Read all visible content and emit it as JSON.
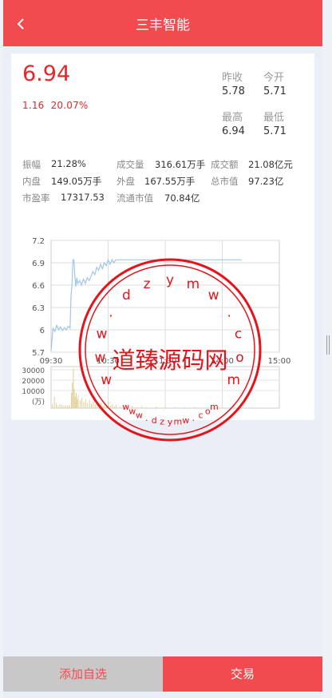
{
  "header": {
    "title": "三丰智能"
  },
  "quote": {
    "price": "6.94",
    "change": "1.16",
    "change_pct": "20.07%",
    "prev_close_label": "昨收",
    "prev_close": "5.78",
    "open_label": "今开",
    "open": "5.71",
    "high_label": "最高",
    "high": "6.94",
    "low_label": "最低",
    "low": "5.71"
  },
  "stats": [
    {
      "label": "振幅",
      "value": "21.28%"
    },
    {
      "label": "成交量",
      "value": "316.61万手"
    },
    {
      "label": "成交额",
      "value": "21.08亿元"
    },
    {
      "label": "内盘",
      "value": "149.05万手"
    },
    {
      "label": "外盘",
      "value": "167.55万手"
    },
    {
      "label": "总市值",
      "value": "97.23亿"
    },
    {
      "label": "市盈率",
      "value": "17317.53"
    },
    {
      "label": "流通市值",
      "value": "70.84亿"
    }
  ],
  "chart_data": {
    "type": "line",
    "price_axis": {
      "ticks": [
        "7.2",
        "6.9",
        "6.6",
        "6.3",
        "6",
        "5.7"
      ],
      "ylim": [
        5.7,
        7.2
      ]
    },
    "time_axis": {
      "ticks": [
        "09:30",
        "10:30",
        "11:30",
        "14:00",
        "15:00"
      ]
    },
    "volume_axis": {
      "ticks": [
        "30000",
        "20000",
        "10000",
        "(万)"
      ]
    },
    "price_series": [
      {
        "t": 0,
        "v": 5.72
      },
      {
        "t": 2,
        "v": 6.02
      },
      {
        "t": 4,
        "v": 5.98
      },
      {
        "t": 6,
        "v": 6.06
      },
      {
        "t": 8,
        "v": 6.0
      },
      {
        "t": 10,
        "v": 6.04
      },
      {
        "t": 12,
        "v": 5.99
      },
      {
        "t": 14,
        "v": 6.03
      },
      {
        "t": 16,
        "v": 6.0
      },
      {
        "t": 18,
        "v": 6.05
      },
      {
        "t": 20,
        "v": 6.02
      },
      {
        "t": 21,
        "v": 6.45
      },
      {
        "t": 22,
        "v": 6.6
      },
      {
        "t": 23,
        "v": 6.94
      },
      {
        "t": 24,
        "v": 6.94
      },
      {
        "t": 25,
        "v": 6.72
      },
      {
        "t": 26,
        "v": 6.58
      },
      {
        "t": 27,
        "v": 6.7
      },
      {
        "t": 28,
        "v": 6.62
      },
      {
        "t": 30,
        "v": 6.66
      },
      {
        "t": 32,
        "v": 6.6
      },
      {
        "t": 34,
        "v": 6.68
      },
      {
        "t": 36,
        "v": 6.62
      },
      {
        "t": 38,
        "v": 6.7
      },
      {
        "t": 40,
        "v": 6.66
      },
      {
        "t": 42,
        "v": 6.72
      },
      {
        "t": 44,
        "v": 6.78
      },
      {
        "t": 46,
        "v": 6.74
      },
      {
        "t": 48,
        "v": 6.84
      },
      {
        "t": 50,
        "v": 6.8
      },
      {
        "t": 52,
        "v": 6.88
      },
      {
        "t": 54,
        "v": 6.82
      },
      {
        "t": 56,
        "v": 6.9
      },
      {
        "t": 58,
        "v": 6.86
      },
      {
        "t": 60,
        "v": 6.94
      },
      {
        "t": 62,
        "v": 6.88
      },
      {
        "t": 64,
        "v": 6.94
      },
      {
        "t": 66,
        "v": 6.9
      },
      {
        "t": 68,
        "v": 6.94
      },
      {
        "t": 70,
        "v": 6.94
      },
      {
        "t": 80,
        "v": 6.94
      },
      {
        "t": 100,
        "v": 6.94
      },
      {
        "t": 120,
        "v": 6.94
      },
      {
        "t": 140,
        "v": 6.94
      },
      {
        "t": 160,
        "v": 6.94
      },
      {
        "t": 180,
        "v": 6.94
      },
      {
        "t": 200,
        "v": 6.94
      }
    ],
    "volume_series": [
      {
        "t": 1,
        "v": 3000
      },
      {
        "t": 3,
        "v": 9000
      },
      {
        "t": 5,
        "v": 4000
      },
      {
        "t": 7,
        "v": 2000
      },
      {
        "t": 9,
        "v": 3000
      },
      {
        "t": 11,
        "v": 2500
      },
      {
        "t": 13,
        "v": 2000
      },
      {
        "t": 15,
        "v": 2200
      },
      {
        "t": 17,
        "v": 1800
      },
      {
        "t": 19,
        "v": 2600
      },
      {
        "t": 21,
        "v": 12000
      },
      {
        "t": 22,
        "v": 20000
      },
      {
        "t": 23,
        "v": 31000
      },
      {
        "t": 24,
        "v": 15000
      },
      {
        "t": 25,
        "v": 9000
      },
      {
        "t": 26,
        "v": 12000
      },
      {
        "t": 27,
        "v": 7000
      },
      {
        "t": 28,
        "v": 10000
      },
      {
        "t": 30,
        "v": 6000
      },
      {
        "t": 32,
        "v": 8000
      },
      {
        "t": 34,
        "v": 5000
      },
      {
        "t": 36,
        "v": 7000
      },
      {
        "t": 38,
        "v": 4000
      },
      {
        "t": 40,
        "v": 6000
      },
      {
        "t": 42,
        "v": 3500
      },
      {
        "t": 44,
        "v": 5000
      },
      {
        "t": 46,
        "v": 3000
      },
      {
        "t": 48,
        "v": 4500
      },
      {
        "t": 50,
        "v": 2500
      },
      {
        "t": 52,
        "v": 4000
      },
      {
        "t": 54,
        "v": 2200
      },
      {
        "t": 56,
        "v": 3500
      },
      {
        "t": 58,
        "v": 2000
      },
      {
        "t": 60,
        "v": 5000
      },
      {
        "t": 62,
        "v": 1800
      },
      {
        "t": 64,
        "v": 3000
      },
      {
        "t": 66,
        "v": 1500
      },
      {
        "t": 68,
        "v": 2500
      },
      {
        "t": 72,
        "v": 1200
      },
      {
        "t": 76,
        "v": 2000
      },
      {
        "t": 80,
        "v": 1000
      },
      {
        "t": 85,
        "v": 1800
      },
      {
        "t": 90,
        "v": 900
      },
      {
        "t": 95,
        "v": 1500
      },
      {
        "t": 100,
        "v": 800
      },
      {
        "t": 110,
        "v": 1200
      },
      {
        "t": 120,
        "v": 700
      },
      {
        "t": 130,
        "v": 1000
      },
      {
        "t": 140,
        "v": 600
      },
      {
        "t": 150,
        "v": 900
      },
      {
        "t": 160,
        "v": 500
      },
      {
        "t": 170,
        "v": 800
      },
      {
        "t": 180,
        "v": 400
      },
      {
        "t": 190,
        "v": 700
      },
      {
        "t": 200,
        "v": 500
      }
    ],
    "t_max": 240,
    "vol_max": 30000,
    "line_color": "#9ec7e8",
    "volume_color": "#e2cf96"
  },
  "watermark": {
    "center_text": "道臻源码网",
    "ring_text": "www.dzymw.com",
    "color": "#e5141b"
  },
  "footer": {
    "add_label": "添加自选",
    "trade_label": "交易"
  }
}
